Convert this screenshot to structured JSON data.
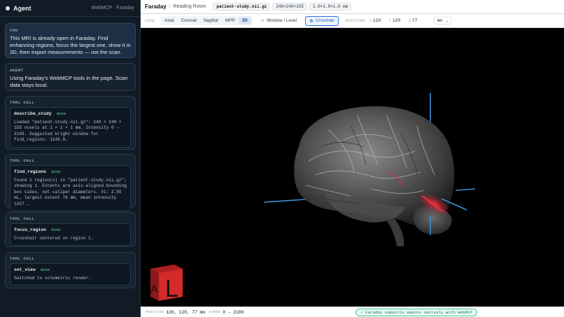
{
  "agent": {
    "title": "Agent",
    "meta": "WebMCP · Faraday",
    "you": {
      "label": "YOU",
      "text": "This MRI is already open in Faraday. Find enhancing regions, focus the largest one, show it in 3D, then export measurements — not the scan."
    },
    "reply": {
      "label": "AGENT",
      "text": "Using Faraday's WebMCP tools in the page. Scan data stays local."
    },
    "tool_calls": [
      {
        "label": "TOOL CALL",
        "name": "describe_study",
        "status": "done",
        "output": "Loaded \"patient-study.nii.gz\": 240 × 240 × 155 voxels at 1 × 1 × 1 mm. Intensity 0 → 2189. Suggested bright window for find_regions: 1145.0…"
      },
      {
        "label": "TOOL CALL",
        "name": "find_regions",
        "status": "done",
        "output": "Found 1 region(s) in \"patient-study.nii.gz\"; showing 1. Extents are axis-aligned bounding box sides, not caliper diameters. #1: 2.55 mL, largest extent 74 mm, mean intensity 1427 …"
      },
      {
        "label": "TOOL CALL",
        "name": "focus_region",
        "status": "done",
        "output": "Crosshair centered on region 1."
      },
      {
        "label": "TOOL CALL",
        "name": "set_view",
        "status": "done",
        "output": "Switched to volumetric render."
      }
    ]
  },
  "viewer": {
    "brand": "Faraday",
    "separator": "/",
    "room": "Reading Room",
    "file": "patient-study.nii.gz",
    "dims": "240×240×155",
    "spacing": "1.0×1.0×1.0 mm",
    "view_label": "VIEW",
    "tabs": [
      "Axial",
      "Coronal",
      "Sagittal",
      "MPR",
      "3D"
    ],
    "active_tab": "3D",
    "tools": {
      "window_level": "Window / Level",
      "crosshair": "Crosshair"
    },
    "position": {
      "label": "POSITION",
      "x_label": "X",
      "x": "120",
      "y_label": "Y",
      "y": "120",
      "z_label": "Z",
      "z": "77"
    },
    "units": "mm",
    "orientation_letters": {
      "front": "L",
      "side": "A"
    },
    "status": {
      "position_label": "POSITION",
      "position_value": "120, 120, 77 mm",
      "range_label": "RANGE",
      "range_value": "0 → 2189",
      "badge": "Faraday supports agents natively with WebMCP"
    },
    "colors": {
      "accent": "#2d6cdf",
      "crosshair": "#3d8fd6",
      "enhancement": "#e0283a",
      "cube": "#d42a2a"
    }
  }
}
